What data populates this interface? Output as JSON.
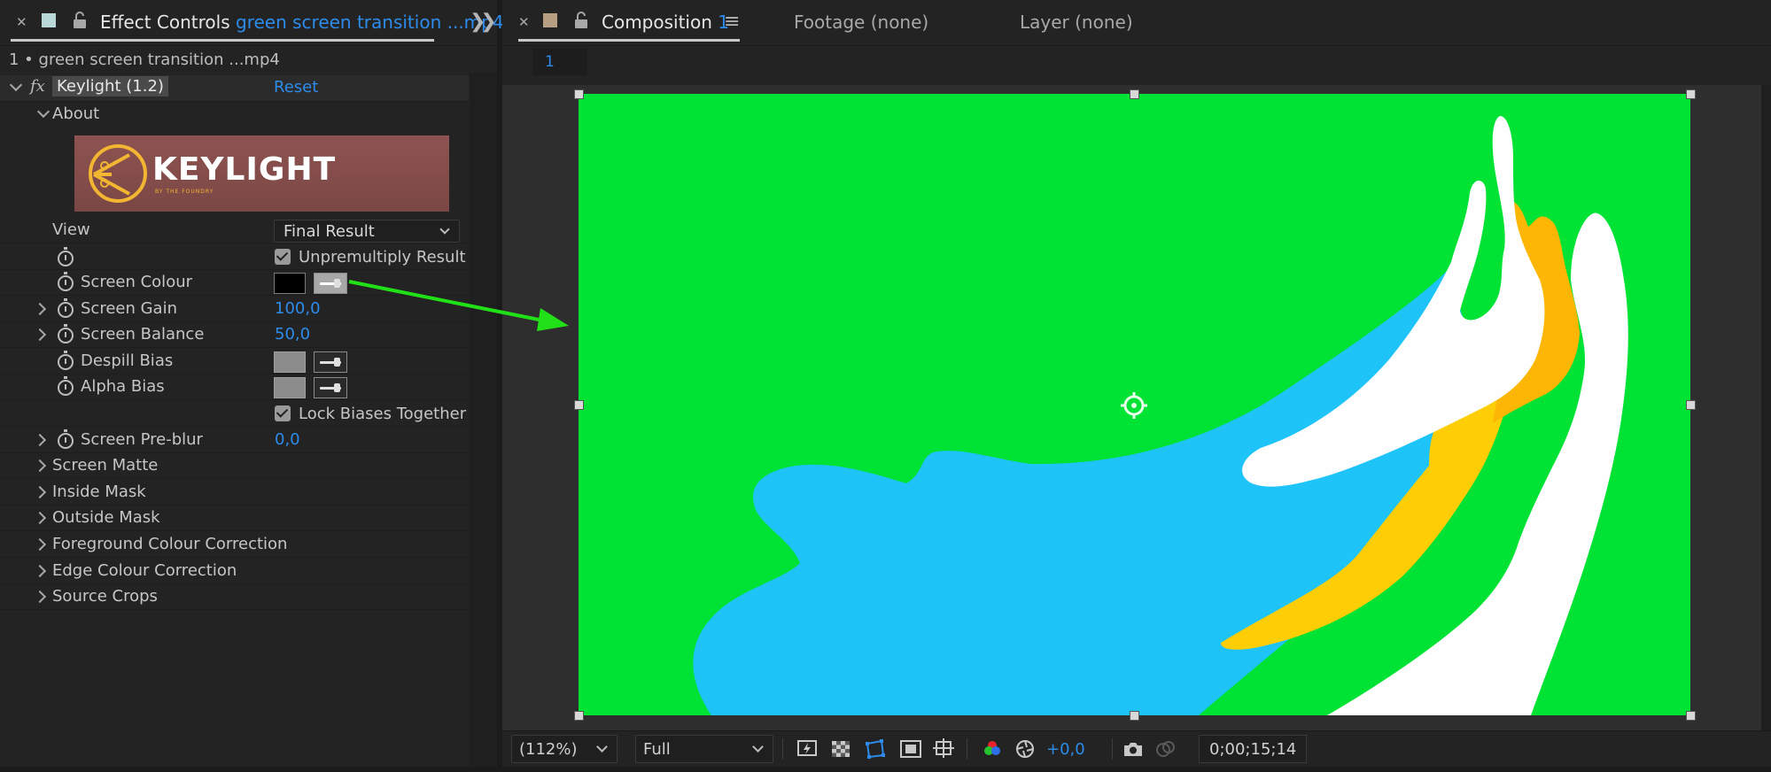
{
  "effect_controls": {
    "tab_title": "Effect Controls",
    "tab_file": "green screen transition ...mp4",
    "layer_label": "1 • green screen transition ...mp4",
    "effect_name": "Keylight (1.2)",
    "reset_label": "Reset",
    "about_label": "About",
    "logo_text": "KEYLIGHT",
    "logo_sub": "BY THE FOUNDRY",
    "view_label": "View",
    "view_value": "Final Result",
    "unpremultiply_label": "Unpremultiply Result",
    "screen_colour_label": "Screen Colour",
    "screen_gain_label": "Screen Gain",
    "screen_gain_value": "100,0",
    "screen_balance_label": "Screen Balance",
    "screen_balance_value": "50,0",
    "despill_bias_label": "Despill Bias",
    "alpha_bias_label": "Alpha Bias",
    "lock_biases_label": "Lock Biases Together",
    "screen_preblur_label": "Screen Pre-blur",
    "screen_preblur_value": "0,0",
    "groups": [
      "Screen Matte",
      "Inside Mask",
      "Outside Mask",
      "Foreground Colour Correction",
      "Edge Colour Correction",
      "Source Crops"
    ]
  },
  "composition": {
    "tab_title": "Composition",
    "tab_number": "1",
    "footage_tab": "Footage (none)",
    "layer_tab": "Layer (none)",
    "comp_index": "1"
  },
  "toolbar": {
    "zoom": "(112%)",
    "resolution": "Full",
    "exposure": "+0,0",
    "timecode": "0;00;15;14"
  },
  "colors": {
    "accent_blue": "#2d8ceb",
    "green_screen": "#00e234",
    "splash_blue": "#1ec3f8",
    "splash_yellow": "#fdcd06",
    "splash_orange": "#fdb604",
    "annotation_arrow": "#21e017"
  }
}
